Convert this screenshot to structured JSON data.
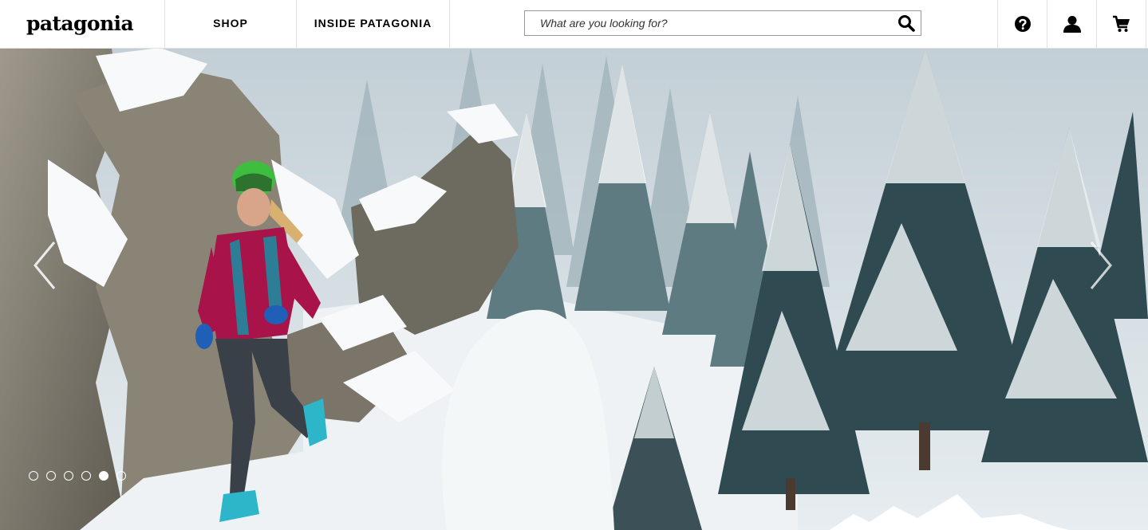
{
  "header": {
    "logo_text": "patagonia",
    "nav": [
      {
        "label": "SHOP"
      },
      {
        "label": "INSIDE PATAGONIA"
      }
    ],
    "search": {
      "placeholder": "What are you looking for?",
      "value": ""
    },
    "icons": [
      "search-icon",
      "help-icon",
      "account-icon",
      "cart-icon"
    ]
  },
  "hero": {
    "slide_count": 6,
    "active_slide": 5,
    "arrows": [
      "chevron-left-icon",
      "chevron-right-icon"
    ]
  },
  "colors": {
    "header_bg": "#ffffff",
    "text": "#000000",
    "snow": "#f4f7f8",
    "jacket": "#a8134a",
    "rock": "#8a8476",
    "tree": "#2f4a50"
  }
}
